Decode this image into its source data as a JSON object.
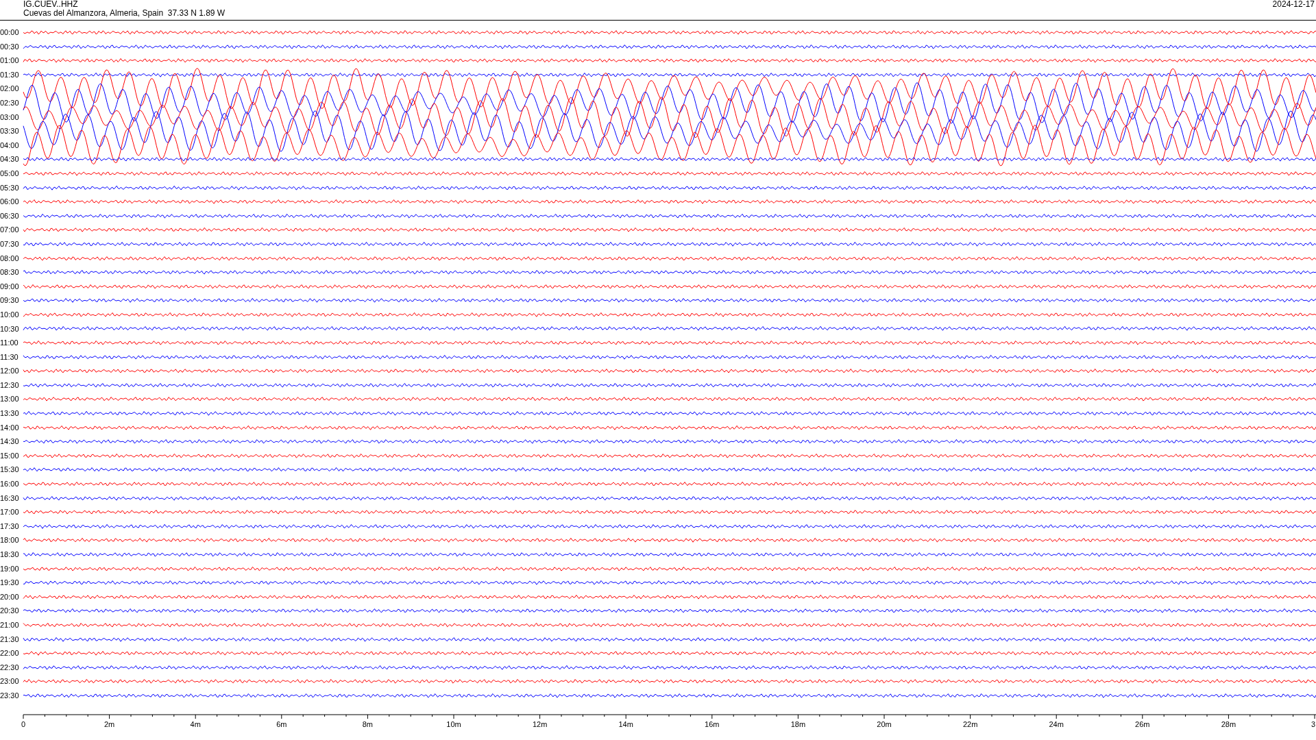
{
  "header": {
    "station": "IG.CUEV..HHZ",
    "location": "Cuevas del Almanzora, Almeria, Spain  37.33 N 1.89 W",
    "date": "2024-12-17"
  },
  "rows": [
    {
      "time": "00:00",
      "color": "#ff0000",
      "kind": "quiet"
    },
    {
      "time": "00:30",
      "color": "#0000ff",
      "kind": "quiet"
    },
    {
      "time": "01:00",
      "color": "#ff0000",
      "kind": "quiet"
    },
    {
      "time": "01:30",
      "color": "#0000ff",
      "kind": "quiet"
    },
    {
      "time": "02:00",
      "color": "#ff0000",
      "kind": "active"
    },
    {
      "time": "02:30",
      "color": "#0000ff",
      "kind": "active"
    },
    {
      "time": "03:00",
      "color": "#ff0000",
      "kind": "active"
    },
    {
      "time": "03:30",
      "color": "#0000ff",
      "kind": "active"
    },
    {
      "time": "04:00",
      "color": "#ff0000",
      "kind": "active"
    },
    {
      "time": "04:30",
      "color": "#0000ff",
      "kind": "quiet"
    },
    {
      "time": "05:00",
      "color": "#ff0000",
      "kind": "quiet"
    },
    {
      "time": "05:30",
      "color": "#0000ff",
      "kind": "quiet"
    },
    {
      "time": "06:00",
      "color": "#ff0000",
      "kind": "quiet"
    },
    {
      "time": "06:30",
      "color": "#0000ff",
      "kind": "quiet"
    },
    {
      "time": "07:00",
      "color": "#ff0000",
      "kind": "quiet"
    },
    {
      "time": "07:30",
      "color": "#0000ff",
      "kind": "quiet"
    },
    {
      "time": "08:00",
      "color": "#ff0000",
      "kind": "quiet"
    },
    {
      "time": "08:30",
      "color": "#0000ff",
      "kind": "quiet"
    },
    {
      "time": "09:00",
      "color": "#ff0000",
      "kind": "quiet"
    },
    {
      "time": "09:30",
      "color": "#0000ff",
      "kind": "quiet"
    },
    {
      "time": "10:00",
      "color": "#ff0000",
      "kind": "quiet"
    },
    {
      "time": "10:30",
      "color": "#0000ff",
      "kind": "quiet"
    },
    {
      "time": "11:00",
      "color": "#ff0000",
      "kind": "quiet"
    },
    {
      "time": "11:30",
      "color": "#0000ff",
      "kind": "quiet"
    },
    {
      "time": "12:00",
      "color": "#ff0000",
      "kind": "quiet"
    },
    {
      "time": "12:30",
      "color": "#0000ff",
      "kind": "quiet"
    },
    {
      "time": "13:00",
      "color": "#ff0000",
      "kind": "quiet"
    },
    {
      "time": "13:30",
      "color": "#0000ff",
      "kind": "quiet"
    },
    {
      "time": "14:00",
      "color": "#ff0000",
      "kind": "quiet"
    },
    {
      "time": "14:30",
      "color": "#0000ff",
      "kind": "quiet"
    },
    {
      "time": "15:00",
      "color": "#ff0000",
      "kind": "quiet"
    },
    {
      "time": "15:30",
      "color": "#0000ff",
      "kind": "quiet"
    },
    {
      "time": "16:00",
      "color": "#ff0000",
      "kind": "quiet"
    },
    {
      "time": "16:30",
      "color": "#0000ff",
      "kind": "quiet"
    },
    {
      "time": "17:00",
      "color": "#ff0000",
      "kind": "quiet"
    },
    {
      "time": "17:30",
      "color": "#0000ff",
      "kind": "quiet"
    },
    {
      "time": "18:00",
      "color": "#ff0000",
      "kind": "quiet"
    },
    {
      "time": "18:30",
      "color": "#0000ff",
      "kind": "quiet"
    },
    {
      "time": "19:00",
      "color": "#ff0000",
      "kind": "quiet"
    },
    {
      "time": "19:30",
      "color": "#0000ff",
      "kind": "quiet"
    },
    {
      "time": "20:00",
      "color": "#ff0000",
      "kind": "quiet"
    },
    {
      "time": "20:30",
      "color": "#0000ff",
      "kind": "quiet"
    },
    {
      "time": "21:00",
      "color": "#ff0000",
      "kind": "quiet"
    },
    {
      "time": "21:30",
      "color": "#0000ff",
      "kind": "quiet"
    },
    {
      "time": "22:00",
      "color": "#ff0000",
      "kind": "quiet"
    },
    {
      "time": "22:30",
      "color": "#0000ff",
      "kind": "quiet"
    },
    {
      "time": "23:00",
      "color": "#ff0000",
      "kind": "quiet"
    },
    {
      "time": "23:30",
      "color": "#0000ff",
      "kind": "quiet"
    }
  ],
  "axis": {
    "labels": [
      "0",
      "2m",
      "4m",
      "6m",
      "8m",
      "10m",
      "12m",
      "14m",
      "16m",
      "18m",
      "20m",
      "22m",
      "24m",
      "26m",
      "28m",
      "3"
    ]
  }
}
